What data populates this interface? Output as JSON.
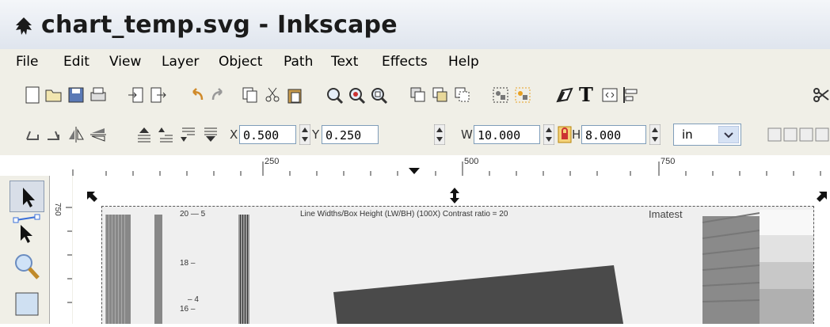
{
  "window": {
    "title": "chart_temp.svg - Inkscape"
  },
  "menu": {
    "items": [
      "File",
      "Edit",
      "View",
      "Layer",
      "Object",
      "Path",
      "Text",
      "Effects",
      "Help"
    ]
  },
  "controls": {
    "x_label": "X",
    "x_value": "0.500",
    "y_label": "Y",
    "y_value": "0.250",
    "w_label": "W",
    "w_value": "10.000",
    "h_label": "H",
    "h_value": "8.000",
    "unit": "in"
  },
  "ruler": {
    "labels": [
      "250",
      "500",
      "750"
    ],
    "left_label": "750"
  },
  "chart": {
    "header": "Line Widths/Box Height (LW/BH) (100X) Contrast ratio = 20",
    "brand": "Imatest",
    "scale_labels": [
      "20 — 5",
      "18 –",
      "16 –",
      "– 4"
    ]
  }
}
